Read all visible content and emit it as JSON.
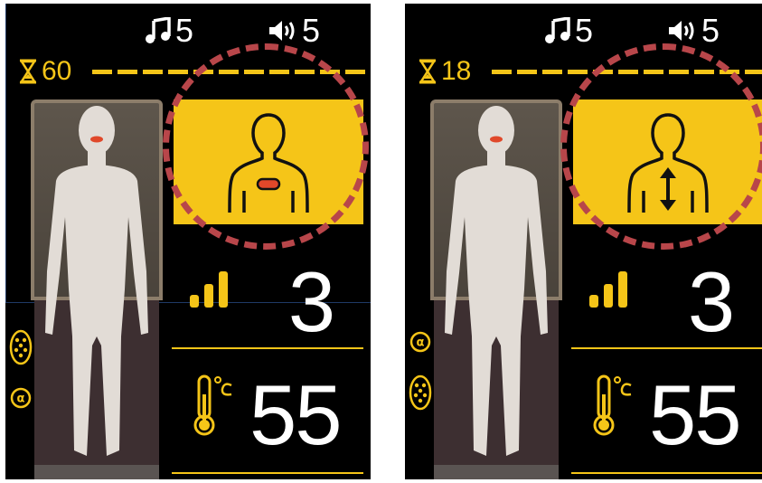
{
  "panels": [
    {
      "music_level": "5",
      "volume_level": "5",
      "timer_value": "60",
      "mode_icon": "upper-body-chest-point-icon",
      "strength": "3",
      "temperature": "55",
      "side_icons": [
        "roller-ball-icon",
        "alpha-wave-icon"
      ]
    },
    {
      "music_level": "5",
      "volume_level": "5",
      "timer_value": "18",
      "mode_icon": "upper-body-updown-arrow-icon",
      "strength": "3",
      "temperature": "55",
      "side_icons": [
        "alpha-wave-icon",
        "roller-ball-icon"
      ]
    }
  ],
  "colors": {
    "accent": "#f5c518",
    "highlight": "#b8464a",
    "background": "#000000",
    "text": "#ffffff",
    "point": "#e0482a"
  }
}
